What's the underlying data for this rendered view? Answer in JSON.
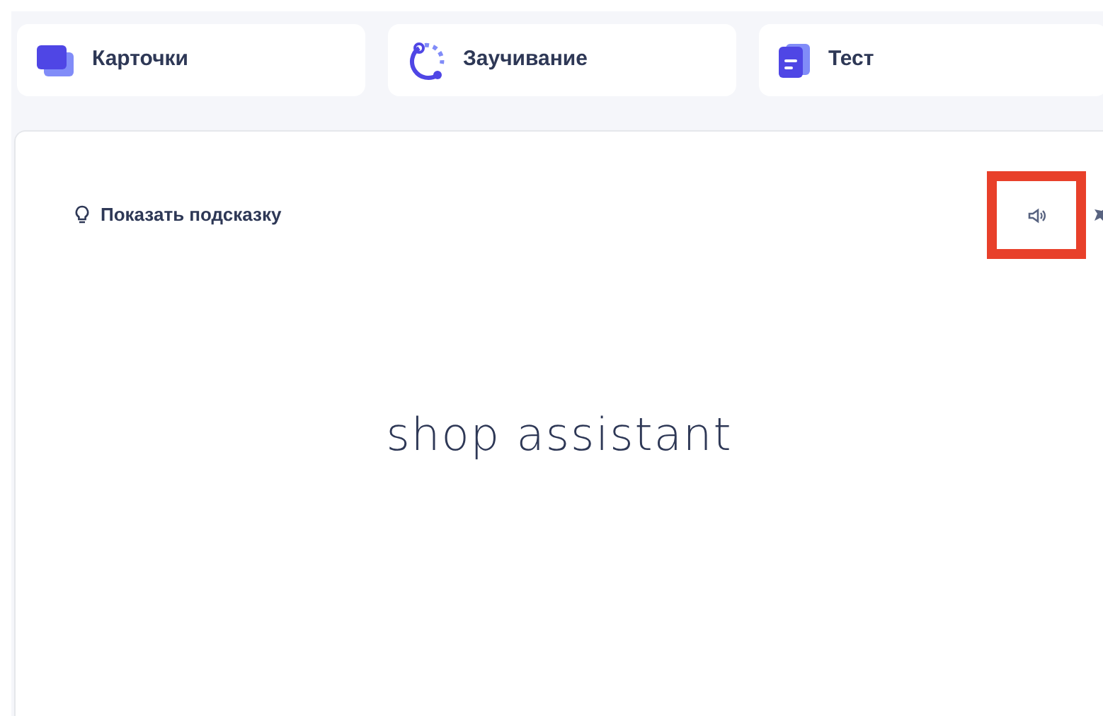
{
  "modes": [
    {
      "kind": "cards",
      "label": "Карточки"
    },
    {
      "kind": "learn",
      "label": "Заучивание"
    },
    {
      "kind": "test",
      "label": "Тест"
    }
  ],
  "card": {
    "hint_label": "Показать подсказку",
    "term": "shop assistant",
    "audio_highlighted": true
  }
}
